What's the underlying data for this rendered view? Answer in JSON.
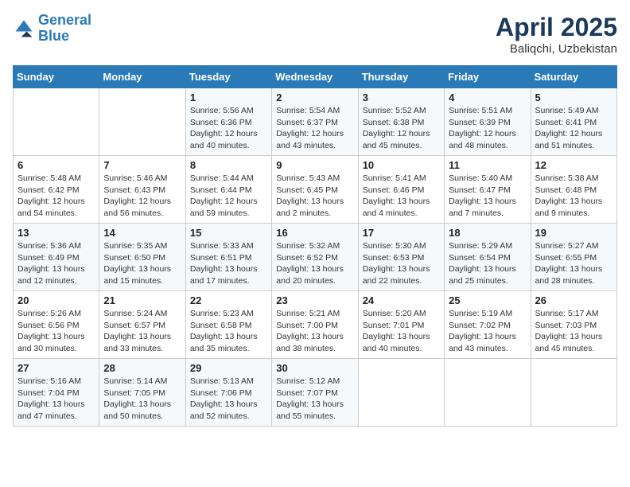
{
  "header": {
    "logo_line1": "General",
    "logo_line2": "Blue",
    "month": "April 2025",
    "location": "Baliqchi, Uzbekistan"
  },
  "weekdays": [
    "Sunday",
    "Monday",
    "Tuesday",
    "Wednesday",
    "Thursday",
    "Friday",
    "Saturday"
  ],
  "weeks": [
    [
      {
        "day": "",
        "sunrise": "",
        "sunset": "",
        "daylight": ""
      },
      {
        "day": "",
        "sunrise": "",
        "sunset": "",
        "daylight": ""
      },
      {
        "day": "1",
        "sunrise": "Sunrise: 5:56 AM",
        "sunset": "Sunset: 6:36 PM",
        "daylight": "Daylight: 12 hours and 40 minutes."
      },
      {
        "day": "2",
        "sunrise": "Sunrise: 5:54 AM",
        "sunset": "Sunset: 6:37 PM",
        "daylight": "Daylight: 12 hours and 43 minutes."
      },
      {
        "day": "3",
        "sunrise": "Sunrise: 5:52 AM",
        "sunset": "Sunset: 6:38 PM",
        "daylight": "Daylight: 12 hours and 45 minutes."
      },
      {
        "day": "4",
        "sunrise": "Sunrise: 5:51 AM",
        "sunset": "Sunset: 6:39 PM",
        "daylight": "Daylight: 12 hours and 48 minutes."
      },
      {
        "day": "5",
        "sunrise": "Sunrise: 5:49 AM",
        "sunset": "Sunset: 6:41 PM",
        "daylight": "Daylight: 12 hours and 51 minutes."
      }
    ],
    [
      {
        "day": "6",
        "sunrise": "Sunrise: 5:48 AM",
        "sunset": "Sunset: 6:42 PM",
        "daylight": "Daylight: 12 hours and 54 minutes."
      },
      {
        "day": "7",
        "sunrise": "Sunrise: 5:46 AM",
        "sunset": "Sunset: 6:43 PM",
        "daylight": "Daylight: 12 hours and 56 minutes."
      },
      {
        "day": "8",
        "sunrise": "Sunrise: 5:44 AM",
        "sunset": "Sunset: 6:44 PM",
        "daylight": "Daylight: 12 hours and 59 minutes."
      },
      {
        "day": "9",
        "sunrise": "Sunrise: 5:43 AM",
        "sunset": "Sunset: 6:45 PM",
        "daylight": "Daylight: 13 hours and 2 minutes."
      },
      {
        "day": "10",
        "sunrise": "Sunrise: 5:41 AM",
        "sunset": "Sunset: 6:46 PM",
        "daylight": "Daylight: 13 hours and 4 minutes."
      },
      {
        "day": "11",
        "sunrise": "Sunrise: 5:40 AM",
        "sunset": "Sunset: 6:47 PM",
        "daylight": "Daylight: 13 hours and 7 minutes."
      },
      {
        "day": "12",
        "sunrise": "Sunrise: 5:38 AM",
        "sunset": "Sunset: 6:48 PM",
        "daylight": "Daylight: 13 hours and 9 minutes."
      }
    ],
    [
      {
        "day": "13",
        "sunrise": "Sunrise: 5:36 AM",
        "sunset": "Sunset: 6:49 PM",
        "daylight": "Daylight: 13 hours and 12 minutes."
      },
      {
        "day": "14",
        "sunrise": "Sunrise: 5:35 AM",
        "sunset": "Sunset: 6:50 PM",
        "daylight": "Daylight: 13 hours and 15 minutes."
      },
      {
        "day": "15",
        "sunrise": "Sunrise: 5:33 AM",
        "sunset": "Sunset: 6:51 PM",
        "daylight": "Daylight: 13 hours and 17 minutes."
      },
      {
        "day": "16",
        "sunrise": "Sunrise: 5:32 AM",
        "sunset": "Sunset: 6:52 PM",
        "daylight": "Daylight: 13 hours and 20 minutes."
      },
      {
        "day": "17",
        "sunrise": "Sunrise: 5:30 AM",
        "sunset": "Sunset: 6:53 PM",
        "daylight": "Daylight: 13 hours and 22 minutes."
      },
      {
        "day": "18",
        "sunrise": "Sunrise: 5:29 AM",
        "sunset": "Sunset: 6:54 PM",
        "daylight": "Daylight: 13 hours and 25 minutes."
      },
      {
        "day": "19",
        "sunrise": "Sunrise: 5:27 AM",
        "sunset": "Sunset: 6:55 PM",
        "daylight": "Daylight: 13 hours and 28 minutes."
      }
    ],
    [
      {
        "day": "20",
        "sunrise": "Sunrise: 5:26 AM",
        "sunset": "Sunset: 6:56 PM",
        "daylight": "Daylight: 13 hours and 30 minutes."
      },
      {
        "day": "21",
        "sunrise": "Sunrise: 5:24 AM",
        "sunset": "Sunset: 6:57 PM",
        "daylight": "Daylight: 13 hours and 33 minutes."
      },
      {
        "day": "22",
        "sunrise": "Sunrise: 5:23 AM",
        "sunset": "Sunset: 6:58 PM",
        "daylight": "Daylight: 13 hours and 35 minutes."
      },
      {
        "day": "23",
        "sunrise": "Sunrise: 5:21 AM",
        "sunset": "Sunset: 7:00 PM",
        "daylight": "Daylight: 13 hours and 38 minutes."
      },
      {
        "day": "24",
        "sunrise": "Sunrise: 5:20 AM",
        "sunset": "Sunset: 7:01 PM",
        "daylight": "Daylight: 13 hours and 40 minutes."
      },
      {
        "day": "25",
        "sunrise": "Sunrise: 5:19 AM",
        "sunset": "Sunset: 7:02 PM",
        "daylight": "Daylight: 13 hours and 43 minutes."
      },
      {
        "day": "26",
        "sunrise": "Sunrise: 5:17 AM",
        "sunset": "Sunset: 7:03 PM",
        "daylight": "Daylight: 13 hours and 45 minutes."
      }
    ],
    [
      {
        "day": "27",
        "sunrise": "Sunrise: 5:16 AM",
        "sunset": "Sunset: 7:04 PM",
        "daylight": "Daylight: 13 hours and 47 minutes."
      },
      {
        "day": "28",
        "sunrise": "Sunrise: 5:14 AM",
        "sunset": "Sunset: 7:05 PM",
        "daylight": "Daylight: 13 hours and 50 minutes."
      },
      {
        "day": "29",
        "sunrise": "Sunrise: 5:13 AM",
        "sunset": "Sunset: 7:06 PM",
        "daylight": "Daylight: 13 hours and 52 minutes."
      },
      {
        "day": "30",
        "sunrise": "Sunrise: 5:12 AM",
        "sunset": "Sunset: 7:07 PM",
        "daylight": "Daylight: 13 hours and 55 minutes."
      },
      {
        "day": "",
        "sunrise": "",
        "sunset": "",
        "daylight": ""
      },
      {
        "day": "",
        "sunrise": "",
        "sunset": "",
        "daylight": ""
      },
      {
        "day": "",
        "sunrise": "",
        "sunset": "",
        "daylight": ""
      }
    ]
  ]
}
